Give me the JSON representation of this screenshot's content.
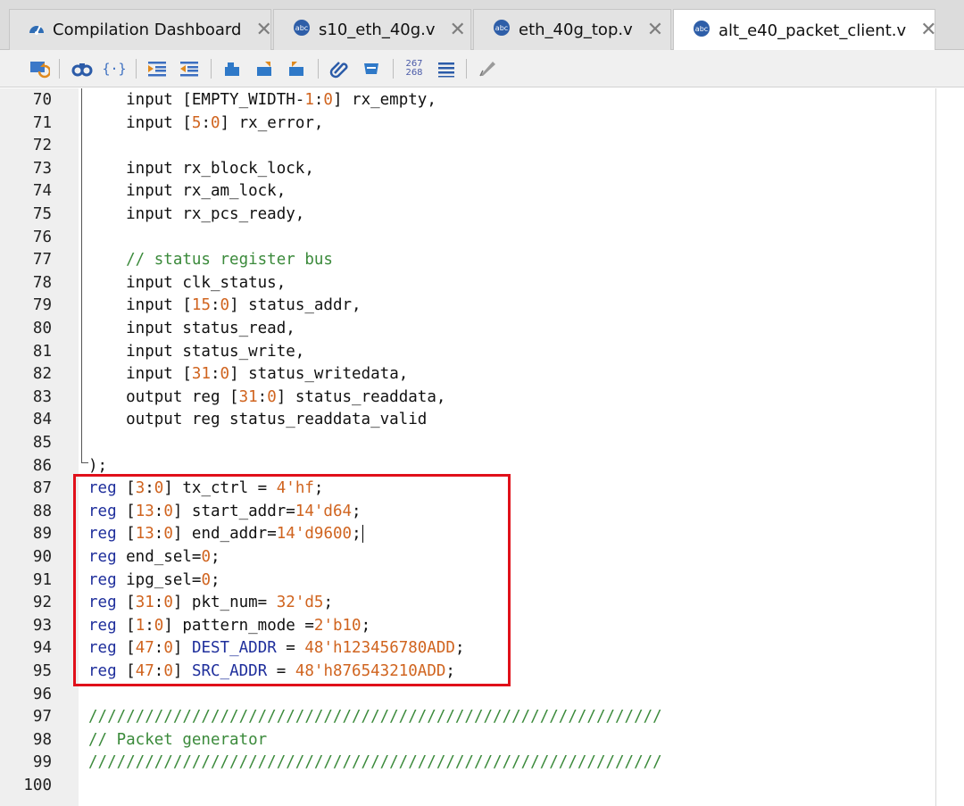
{
  "tabs": [
    {
      "label": "Compilation Dashboard",
      "icon": "dashboard-icon",
      "active": false
    },
    {
      "label": "s10_eth_40g.v",
      "icon": "verilog-file-icon",
      "active": false
    },
    {
      "label": "eth_40g_top.v",
      "icon": "verilog-file-icon",
      "active": false
    },
    {
      "label": "alt_e40_packet_client.v",
      "icon": "verilog-file-icon",
      "active": true
    }
  ],
  "toolbar": {
    "items": [
      "refresh-icon",
      "find-icon",
      "brace-icon",
      "indent-icon",
      "unindent-icon",
      "bookmark-icon",
      "bookmark-next-icon",
      "bookmark-prev-icon",
      "attach-icon",
      "comment-icon",
      "line-numbers-icon",
      "align-icon",
      "pen-icon"
    ],
    "line_numbers_top": "267",
    "line_numbers_bottom": "268"
  },
  "editor": {
    "lines": [
      {
        "n": "70",
        "tokens": [
          [
            "",
            "    input [EMPTY_WIDTH-"
          ],
          [
            "num",
            "1"
          ],
          [
            "",
            ":"
          ],
          [
            "num",
            "0"
          ],
          [
            "",
            "] rx_empty,"
          ]
        ]
      },
      {
        "n": "71",
        "tokens": [
          [
            "",
            "    input ["
          ],
          [
            "num",
            "5"
          ],
          [
            "",
            ":"
          ],
          [
            "num",
            "0"
          ],
          [
            "",
            "] rx_error,"
          ]
        ]
      },
      {
        "n": "72",
        "tokens": []
      },
      {
        "n": "73",
        "tokens": [
          [
            "",
            "    input rx_block_lock,"
          ]
        ]
      },
      {
        "n": "74",
        "tokens": [
          [
            "",
            "    input rx_am_lock,"
          ]
        ]
      },
      {
        "n": "75",
        "tokens": [
          [
            "",
            "    input rx_pcs_ready,"
          ]
        ]
      },
      {
        "n": "76",
        "tokens": []
      },
      {
        "n": "77",
        "tokens": [
          [
            "cm",
            "    // status register bus"
          ]
        ]
      },
      {
        "n": "78",
        "tokens": [
          [
            "",
            "    input clk_status,"
          ]
        ]
      },
      {
        "n": "79",
        "tokens": [
          [
            "",
            "    input ["
          ],
          [
            "num",
            "15"
          ],
          [
            "",
            ":"
          ],
          [
            "num",
            "0"
          ],
          [
            "",
            "] status_addr,"
          ]
        ]
      },
      {
        "n": "80",
        "tokens": [
          [
            "",
            "    input status_read,"
          ]
        ]
      },
      {
        "n": "81",
        "tokens": [
          [
            "",
            "    input status_write,"
          ]
        ]
      },
      {
        "n": "82",
        "tokens": [
          [
            "",
            "    input ["
          ],
          [
            "num",
            "31"
          ],
          [
            "",
            ":"
          ],
          [
            "num",
            "0"
          ],
          [
            "",
            "] status_writedata,"
          ]
        ]
      },
      {
        "n": "83",
        "tokens": [
          [
            "",
            "    output reg ["
          ],
          [
            "num",
            "31"
          ],
          [
            "",
            ":"
          ],
          [
            "num",
            "0"
          ],
          [
            "",
            "] status_readdata,"
          ]
        ]
      },
      {
        "n": "84",
        "tokens": [
          [
            "",
            "    output reg status_readdata_valid"
          ]
        ]
      },
      {
        "n": "85",
        "tokens": []
      },
      {
        "n": "86",
        "tokens": [
          [
            "",
            ");"
          ]
        ]
      },
      {
        "n": "87",
        "tokens": [
          [
            "kw",
            "reg"
          ],
          [
            "",
            " ["
          ],
          [
            "num",
            "3"
          ],
          [
            "",
            ":"
          ],
          [
            "num",
            "0"
          ],
          [
            "",
            "] tx_ctrl = "
          ],
          [
            "num",
            "4'hf"
          ],
          [
            "",
            ";"
          ]
        ]
      },
      {
        "n": "88",
        "tokens": [
          [
            "kw",
            "reg"
          ],
          [
            "",
            " ["
          ],
          [
            "num",
            "13"
          ],
          [
            "",
            ":"
          ],
          [
            "num",
            "0"
          ],
          [
            "",
            "] start_addr="
          ],
          [
            "num",
            "14'd64"
          ],
          [
            "",
            ";"
          ]
        ]
      },
      {
        "n": "89",
        "tokens": [
          [
            "kw",
            "reg"
          ],
          [
            "",
            " ["
          ],
          [
            "num",
            "13"
          ],
          [
            "",
            ":"
          ],
          [
            "num",
            "0"
          ],
          [
            "",
            "] end_addr="
          ],
          [
            "num",
            "14'd9600"
          ],
          [
            "",
            ";"
          ]
        ],
        "caret": true
      },
      {
        "n": "90",
        "tokens": [
          [
            "kw",
            "reg"
          ],
          [
            "",
            " end_sel="
          ],
          [
            "num",
            "0"
          ],
          [
            "",
            ";"
          ]
        ]
      },
      {
        "n": "91",
        "tokens": [
          [
            "kw",
            "reg"
          ],
          [
            "",
            " ipg_sel="
          ],
          [
            "num",
            "0"
          ],
          [
            "",
            ";"
          ]
        ]
      },
      {
        "n": "92",
        "tokens": [
          [
            "kw",
            "reg"
          ],
          [
            "",
            " ["
          ],
          [
            "num",
            "31"
          ],
          [
            "",
            ":"
          ],
          [
            "num",
            "0"
          ],
          [
            "",
            "] pkt_num= "
          ],
          [
            "num",
            "32'd5"
          ],
          [
            "",
            ";"
          ]
        ]
      },
      {
        "n": "93",
        "tokens": [
          [
            "kw",
            "reg"
          ],
          [
            "",
            " ["
          ],
          [
            "num",
            "1"
          ],
          [
            "",
            ":"
          ],
          [
            "num",
            "0"
          ],
          [
            "",
            "] pattern_mode ="
          ],
          [
            "num",
            "2'b10"
          ],
          [
            "",
            ";"
          ]
        ]
      },
      {
        "n": "94",
        "tokens": [
          [
            "kw",
            "reg"
          ],
          [
            "",
            " ["
          ],
          [
            "num",
            "47"
          ],
          [
            "",
            ":"
          ],
          [
            "num",
            "0"
          ],
          [
            "",
            "] "
          ],
          [
            "kw",
            "DEST_ADDR"
          ],
          [
            "",
            " = "
          ],
          [
            "num",
            "48'h123456780ADD"
          ],
          [
            "",
            ";"
          ]
        ]
      },
      {
        "n": "95",
        "tokens": [
          [
            "kw",
            "reg"
          ],
          [
            "",
            " ["
          ],
          [
            "num",
            "47"
          ],
          [
            "",
            ":"
          ],
          [
            "num",
            "0"
          ],
          [
            "",
            "] "
          ],
          [
            "kw",
            "SRC_ADDR"
          ],
          [
            "",
            " = "
          ],
          [
            "num",
            "48'h876543210ADD"
          ],
          [
            "",
            ";"
          ]
        ]
      },
      {
        "n": "96",
        "tokens": []
      },
      {
        "n": "97",
        "tokens": [
          [
            "cm",
            "/////////////////////////////////////////////////////////////"
          ]
        ]
      },
      {
        "n": "98",
        "tokens": [
          [
            "cm",
            "// Packet generator"
          ]
        ]
      },
      {
        "n": "99",
        "tokens": [
          [
            "cm",
            "/////////////////////////////////////////////////////////////"
          ]
        ]
      },
      {
        "n": "100",
        "tokens": []
      }
    ]
  },
  "colors": {
    "keyword": "#1f2f9c",
    "number": "#d0641f",
    "comment": "#3b8a3b",
    "highlight_box": "#e0101a"
  }
}
